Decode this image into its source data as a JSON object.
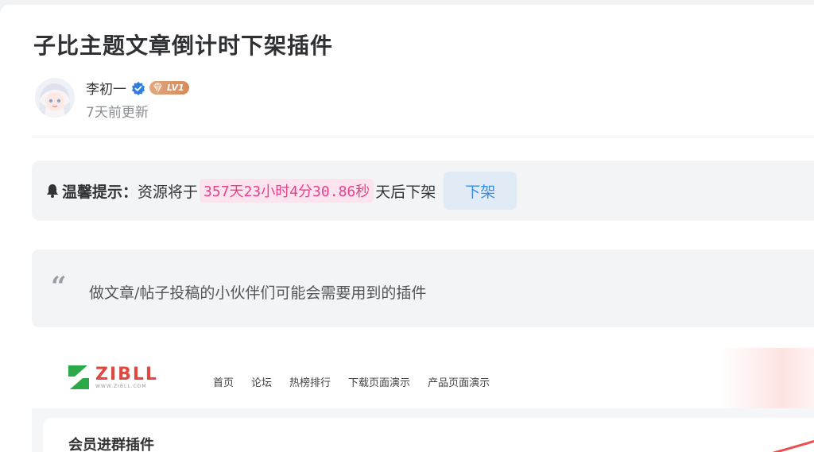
{
  "article": {
    "title": "子比主题文章倒计时下架插件",
    "author": {
      "name": "李初一",
      "level": "LV1",
      "updated": "7天前更新"
    }
  },
  "notice": {
    "label": "温馨提示：",
    "text_before": "资源将于",
    "countdown": "357天23小时4分30.86秒",
    "text_after": "天后下架",
    "button_label": "下架"
  },
  "quote": {
    "text": "做文章/帖子投稿的小伙伴们可能会需要用到的插件"
  },
  "preview": {
    "logo_name": "ZIBLL",
    "logo_sub": "WWW.ZIBLL.COM",
    "nav": [
      "首页",
      "论坛",
      "热榜排行",
      "下载页面演示",
      "产品页面演示"
    ],
    "card_title": "会员进群插件"
  },
  "colors": {
    "countdown_text": "#e8418d",
    "countdown_bg": "#fce4ee",
    "button_text": "#3a8ee6",
    "button_bg": "#e1ebf6",
    "brand_red": "#e0493f",
    "brand_green": "#2aa84a",
    "verified_blue": "#2f7de1",
    "level_badge": "#d58a5c"
  },
  "icons": {
    "verified": "verified-check-icon",
    "level": "diamond-gem-icon",
    "notice": "bell-icon",
    "quote": "quote-mark-icon"
  }
}
